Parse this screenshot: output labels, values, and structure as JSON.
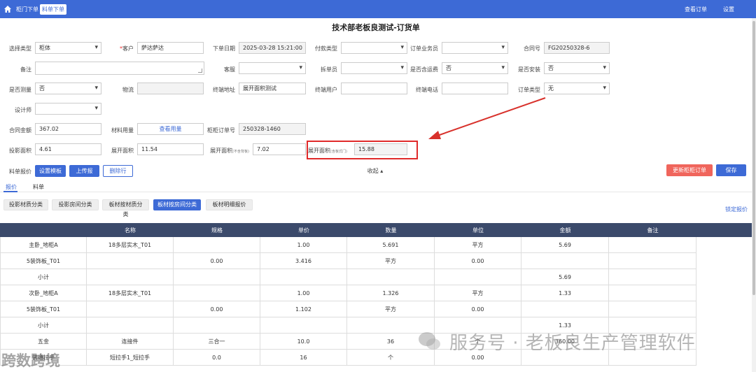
{
  "nav": {
    "tabs": [
      "柜门下单",
      "料单下单"
    ],
    "right": [
      "查看订单",
      "设置"
    ]
  },
  "page_title": "技术部老板良测试-订货单",
  "form": {
    "select_type": {
      "label": "选择类型",
      "value": "柜体"
    },
    "customer": {
      "label": "客户",
      "value": "萨达萨达"
    },
    "order_date": {
      "label": "下单日期",
      "value": "2025-03-28 15:21:00"
    },
    "payment_type": {
      "label": "付款类型",
      "value": ""
    },
    "salesperson": {
      "label": "订单业务员",
      "value": ""
    },
    "contract_no": {
      "label": "合同号",
      "value": "FG20250328-6"
    },
    "remark": {
      "label": "备注",
      "value": ""
    },
    "service": {
      "label": "客服",
      "value": ""
    },
    "splitter": {
      "label": "拆单员",
      "value": ""
    },
    "shipping": {
      "label": "是否含运费",
      "value": "否"
    },
    "install": {
      "label": "是否安装",
      "value": "否"
    },
    "measure": {
      "label": "是否测量",
      "value": "否"
    },
    "logistics": {
      "label": "物流",
      "value": ""
    },
    "end_address": {
      "label": "终端地址",
      "value": "展开面积测试"
    },
    "end_user": {
      "label": "终端用户",
      "value": ""
    },
    "end_phone": {
      "label": "终端电话",
      "value": ""
    },
    "order_kind": {
      "label": "订单类型",
      "value": "无"
    },
    "designer": {
      "label": "设计师",
      "value": ""
    },
    "contract_amount": {
      "label": "合同金额",
      "value": "367.02"
    },
    "material_usage": {
      "label": "材料用量",
      "value": "查看用量"
    },
    "cabinet_order_no": {
      "label": "柜柜订单号",
      "value": "250328-1460"
    },
    "proj_area": {
      "label": "投影面积",
      "value": "4.61"
    },
    "expand_area": {
      "label": "展开面积",
      "value": "11.54"
    },
    "expand_area_nb": {
      "label": "展开面积",
      "sub": "(不含背板)",
      "value": "7.02"
    },
    "expand_area_door": {
      "label": "展开面积",
      "sub": "(含板式门)",
      "value": "15.88"
    }
  },
  "actions": {
    "quote_label": "料单报价",
    "set_template": "设置模板",
    "upload_quote": "上传报价",
    "delete_row": "删除行",
    "collapse": "收起 ▴",
    "refresh": "更新柜柜订单",
    "save": "保存"
  },
  "tabs": [
    "报价",
    "料单"
  ],
  "filters": [
    "投影材质分类",
    "投影房间分类",
    "板材按材质分类",
    "板材按房间分类",
    "板材明细报价"
  ],
  "lock_quote": "锁定报价",
  "table": {
    "headers": [
      "名称",
      "规格",
      "单价",
      "数量",
      "单位",
      "金额",
      "备注"
    ],
    "rows": [
      [
        "主卧_地柜A",
        "18多层实木_T01",
        "",
        "1.00",
        "5.691",
        "平方",
        "5.69",
        ""
      ],
      [
        "5装饰板_T01",
        "",
        "0.00",
        "3.416",
        "平方",
        "0.00",
        "",
        ""
      ],
      [
        "小计",
        "",
        "",
        "",
        "",
        "",
        "5.69",
        ""
      ],
      [
        "次卧_地柜A",
        "18多层实木_T01",
        "",
        "1.00",
        "1.326",
        "平方",
        "1.33",
        ""
      ],
      [
        "5装饰板_T01",
        "",
        "0.00",
        "1.102",
        "平方",
        "0.00",
        "",
        ""
      ],
      [
        "小计",
        "",
        "",
        "",
        "",
        "",
        "1.33",
        ""
      ],
      [
        "五金",
        "连接件",
        "三合一",
        "10.0",
        "36",
        "个",
        "360.00",
        ""
      ],
      [
        "普通拉手",
        "短拉手1_短拉手",
        "0.0",
        "16",
        "个",
        "0.00",
        "",
        ""
      ]
    ]
  },
  "watermark": "服务号 · 老板良生产管理软件",
  "watermark2": "跨数跨境"
}
